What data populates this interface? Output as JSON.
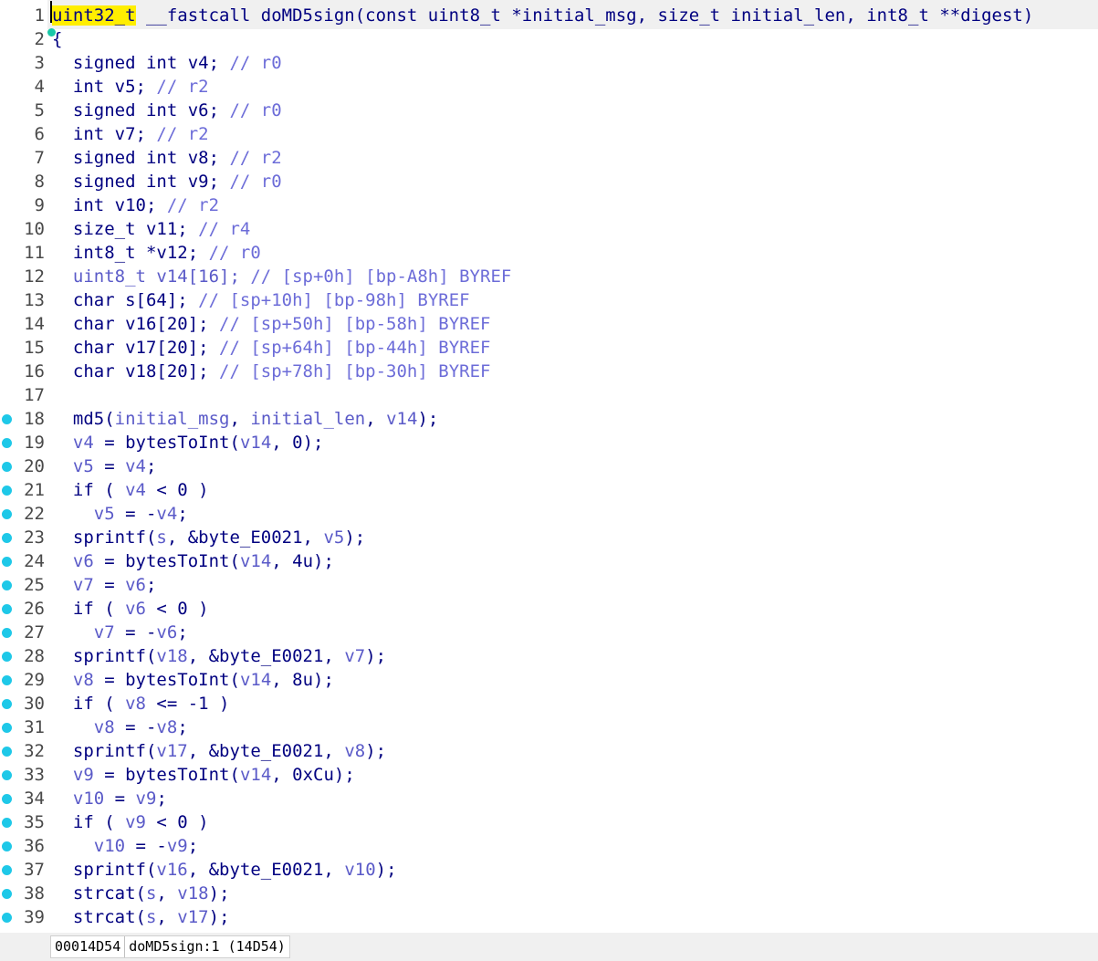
{
  "editor": {
    "lines": [
      {
        "num": "1",
        "bp": false,
        "tokens": [
          {
            "t": "uint32_t",
            "c": "cursor-word"
          },
          {
            "t": " __fastcall doMD5sign(const uint8_t *initial_msg, size_t initial_len, int8_t **digest)"
          }
        ]
      },
      {
        "num": "2",
        "bp": false,
        "tokens": [
          {
            "t": "{"
          }
        ]
      },
      {
        "num": "3",
        "bp": false,
        "tokens": [
          {
            "t": "  signed int v4; "
          },
          {
            "t": "// r0",
            "c": "cm"
          }
        ]
      },
      {
        "num": "4",
        "bp": false,
        "tokens": [
          {
            "t": "  int v5; "
          },
          {
            "t": "// r2",
            "c": "cm"
          }
        ]
      },
      {
        "num": "5",
        "bp": false,
        "tokens": [
          {
            "t": "  signed int v6; "
          },
          {
            "t": "// r0",
            "c": "cm"
          }
        ]
      },
      {
        "num": "6",
        "bp": false,
        "tokens": [
          {
            "t": "  int v7; "
          },
          {
            "t": "// r2",
            "c": "cm"
          }
        ]
      },
      {
        "num": "7",
        "bp": false,
        "tokens": [
          {
            "t": "  signed int v8; "
          },
          {
            "t": "// r2",
            "c": "cm"
          }
        ]
      },
      {
        "num": "8",
        "bp": false,
        "tokens": [
          {
            "t": "  signed int v9; "
          },
          {
            "t": "// r0",
            "c": "cm"
          }
        ]
      },
      {
        "num": "9",
        "bp": false,
        "tokens": [
          {
            "t": "  int v10; "
          },
          {
            "t": "// r2",
            "c": "cm"
          }
        ]
      },
      {
        "num": "10",
        "bp": false,
        "tokens": [
          {
            "t": "  size_t v11; "
          },
          {
            "t": "// r4",
            "c": "cm"
          }
        ]
      },
      {
        "num": "11",
        "bp": false,
        "tokens": [
          {
            "t": "  int8_t *v12; "
          },
          {
            "t": "// r0",
            "c": "cm"
          }
        ]
      },
      {
        "num": "12",
        "bp": false,
        "tokens": [
          {
            "t": "  uint8_t v14[16]; ",
            "c": "vr"
          },
          {
            "t": "// [sp+0h] [bp-A8h] BYREF",
            "c": "cm"
          }
        ]
      },
      {
        "num": "13",
        "bp": false,
        "tokens": [
          {
            "t": "  char s[64]; "
          },
          {
            "t": "// [sp+10h] [bp-98h] BYREF",
            "c": "cm"
          }
        ]
      },
      {
        "num": "14",
        "bp": false,
        "tokens": [
          {
            "t": "  char v16[20]; "
          },
          {
            "t": "// [sp+50h] [bp-58h] BYREF",
            "c": "cm"
          }
        ]
      },
      {
        "num": "15",
        "bp": false,
        "tokens": [
          {
            "t": "  char v17[20]; "
          },
          {
            "t": "// [sp+64h] [bp-44h] BYREF",
            "c": "cm"
          }
        ]
      },
      {
        "num": "16",
        "bp": false,
        "tokens": [
          {
            "t": "  char v18[20]; "
          },
          {
            "t": "// [sp+78h] [bp-30h] BYREF",
            "c": "cm"
          }
        ]
      },
      {
        "num": "17",
        "bp": false,
        "tokens": []
      },
      {
        "num": "18",
        "bp": true,
        "tokens": [
          {
            "t": "  md5("
          },
          {
            "t": "initial_msg",
            "c": "vr"
          },
          {
            "t": ", "
          },
          {
            "t": "initial_len",
            "c": "vr"
          },
          {
            "t": ", "
          },
          {
            "t": "v14",
            "c": "vr"
          },
          {
            "t": ");"
          }
        ]
      },
      {
        "num": "19",
        "bp": true,
        "tokens": [
          {
            "t": "  "
          },
          {
            "t": "v4",
            "c": "vr"
          },
          {
            "t": " = bytesToInt("
          },
          {
            "t": "v14",
            "c": "vr"
          },
          {
            "t": ", 0);"
          }
        ]
      },
      {
        "num": "20",
        "bp": true,
        "tokens": [
          {
            "t": "  "
          },
          {
            "t": "v5",
            "c": "vr"
          },
          {
            "t": " = "
          },
          {
            "t": "v4",
            "c": "vr"
          },
          {
            "t": ";"
          }
        ]
      },
      {
        "num": "21",
        "bp": true,
        "tokens": [
          {
            "t": "  if ( "
          },
          {
            "t": "v4",
            "c": "vr"
          },
          {
            "t": " < 0 )"
          }
        ]
      },
      {
        "num": "22",
        "bp": true,
        "tokens": [
          {
            "t": "    "
          },
          {
            "t": "v5",
            "c": "vr"
          },
          {
            "t": " = -"
          },
          {
            "t": "v4",
            "c": "vr"
          },
          {
            "t": ";"
          }
        ]
      },
      {
        "num": "23",
        "bp": true,
        "tokens": [
          {
            "t": "  sprintf("
          },
          {
            "t": "s",
            "c": "vr"
          },
          {
            "t": ", &byte_E0021, "
          },
          {
            "t": "v5",
            "c": "vr"
          },
          {
            "t": ");"
          }
        ]
      },
      {
        "num": "24",
        "bp": true,
        "tokens": [
          {
            "t": "  "
          },
          {
            "t": "v6",
            "c": "vr"
          },
          {
            "t": " = bytesToInt("
          },
          {
            "t": "v14",
            "c": "vr"
          },
          {
            "t": ", 4u);"
          }
        ]
      },
      {
        "num": "25",
        "bp": true,
        "tokens": [
          {
            "t": "  "
          },
          {
            "t": "v7",
            "c": "vr"
          },
          {
            "t": " = "
          },
          {
            "t": "v6",
            "c": "vr"
          },
          {
            "t": ";"
          }
        ]
      },
      {
        "num": "26",
        "bp": true,
        "tokens": [
          {
            "t": "  if ( "
          },
          {
            "t": "v6",
            "c": "vr"
          },
          {
            "t": " < 0 )"
          }
        ]
      },
      {
        "num": "27",
        "bp": true,
        "tokens": [
          {
            "t": "    "
          },
          {
            "t": "v7",
            "c": "vr"
          },
          {
            "t": " = -"
          },
          {
            "t": "v6",
            "c": "vr"
          },
          {
            "t": ";"
          }
        ]
      },
      {
        "num": "28",
        "bp": true,
        "tokens": [
          {
            "t": "  sprintf("
          },
          {
            "t": "v18",
            "c": "vr"
          },
          {
            "t": ", &byte_E0021, "
          },
          {
            "t": "v7",
            "c": "vr"
          },
          {
            "t": ");"
          }
        ]
      },
      {
        "num": "29",
        "bp": true,
        "tokens": [
          {
            "t": "  "
          },
          {
            "t": "v8",
            "c": "vr"
          },
          {
            "t": " = bytesToInt("
          },
          {
            "t": "v14",
            "c": "vr"
          },
          {
            "t": ", 8u);"
          }
        ]
      },
      {
        "num": "30",
        "bp": true,
        "tokens": [
          {
            "t": "  if ( "
          },
          {
            "t": "v8",
            "c": "vr"
          },
          {
            "t": " <= -1 )"
          }
        ]
      },
      {
        "num": "31",
        "bp": true,
        "tokens": [
          {
            "t": "    "
          },
          {
            "t": "v8",
            "c": "vr"
          },
          {
            "t": " = -"
          },
          {
            "t": "v8",
            "c": "vr"
          },
          {
            "t": ";"
          }
        ]
      },
      {
        "num": "32",
        "bp": true,
        "tokens": [
          {
            "t": "  sprintf("
          },
          {
            "t": "v17",
            "c": "vr"
          },
          {
            "t": ", &byte_E0021, "
          },
          {
            "t": "v8",
            "c": "vr"
          },
          {
            "t": ");"
          }
        ]
      },
      {
        "num": "33",
        "bp": true,
        "tokens": [
          {
            "t": "  "
          },
          {
            "t": "v9",
            "c": "vr"
          },
          {
            "t": " = bytesToInt("
          },
          {
            "t": "v14",
            "c": "vr"
          },
          {
            "t": ", 0xCu);"
          }
        ]
      },
      {
        "num": "34",
        "bp": true,
        "tokens": [
          {
            "t": "  "
          },
          {
            "t": "v10",
            "c": "vr"
          },
          {
            "t": " = "
          },
          {
            "t": "v9",
            "c": "vr"
          },
          {
            "t": ";"
          }
        ]
      },
      {
        "num": "35",
        "bp": true,
        "tokens": [
          {
            "t": "  if ( "
          },
          {
            "t": "v9",
            "c": "vr"
          },
          {
            "t": " < 0 )"
          }
        ]
      },
      {
        "num": "36",
        "bp": true,
        "tokens": [
          {
            "t": "    "
          },
          {
            "t": "v10",
            "c": "vr"
          },
          {
            "t": " = -"
          },
          {
            "t": "v9",
            "c": "vr"
          },
          {
            "t": ";"
          }
        ]
      },
      {
        "num": "37",
        "bp": true,
        "tokens": [
          {
            "t": "  sprintf("
          },
          {
            "t": "v16",
            "c": "vr"
          },
          {
            "t": ", &byte_E0021, "
          },
          {
            "t": "v10",
            "c": "vr"
          },
          {
            "t": ");"
          }
        ]
      },
      {
        "num": "38",
        "bp": true,
        "tokens": [
          {
            "t": "  strcat("
          },
          {
            "t": "s",
            "c": "vr"
          },
          {
            "t": ", "
          },
          {
            "t": "v18",
            "c": "vr"
          },
          {
            "t": ");"
          }
        ]
      },
      {
        "num": "39",
        "bp": true,
        "tokens": [
          {
            "t": "  strcat("
          },
          {
            "t": "s",
            "c": "vr"
          },
          {
            "t": ", "
          },
          {
            "t": "v17",
            "c": "vr"
          },
          {
            "t": ");"
          }
        ]
      }
    ]
  },
  "status": {
    "address": "00014D54",
    "location": "doMD5sign:1 (14D54)"
  },
  "colors": {
    "code": "#000080",
    "variable": "#5a5ac8",
    "comment": "#6c6cd8",
    "breakpoint": "#1ec8e8",
    "cursor_highlight": "#ffee00"
  }
}
